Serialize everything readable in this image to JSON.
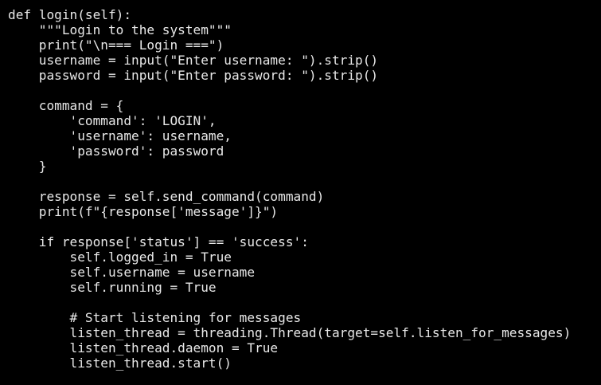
{
  "code": {
    "language": "python",
    "lines": [
      "def login(self):",
      "    \"\"\"Login to the system\"\"\"",
      "    print(\"\\n=== Login ===\")",
      "    username = input(\"Enter username: \").strip()",
      "    password = input(\"Enter password: \").strip()",
      "",
      "    command = {",
      "        'command': 'LOGIN',",
      "        'username': username,",
      "        'password': password",
      "    }",
      "",
      "    response = self.send_command(command)",
      "    print(f\"{response['message']}\")",
      "",
      "    if response['status'] == 'success':",
      "        self.logged_in = True",
      "        self.username = username",
      "        self.running = True",
      "",
      "        # Start listening for messages",
      "        listen_thread = threading.Thread(target=self.listen_for_messages)",
      "        listen_thread.daemon = True",
      "        listen_thread.start()"
    ]
  },
  "colors": {
    "background": "#000000",
    "text": "#e8e8e8"
  }
}
